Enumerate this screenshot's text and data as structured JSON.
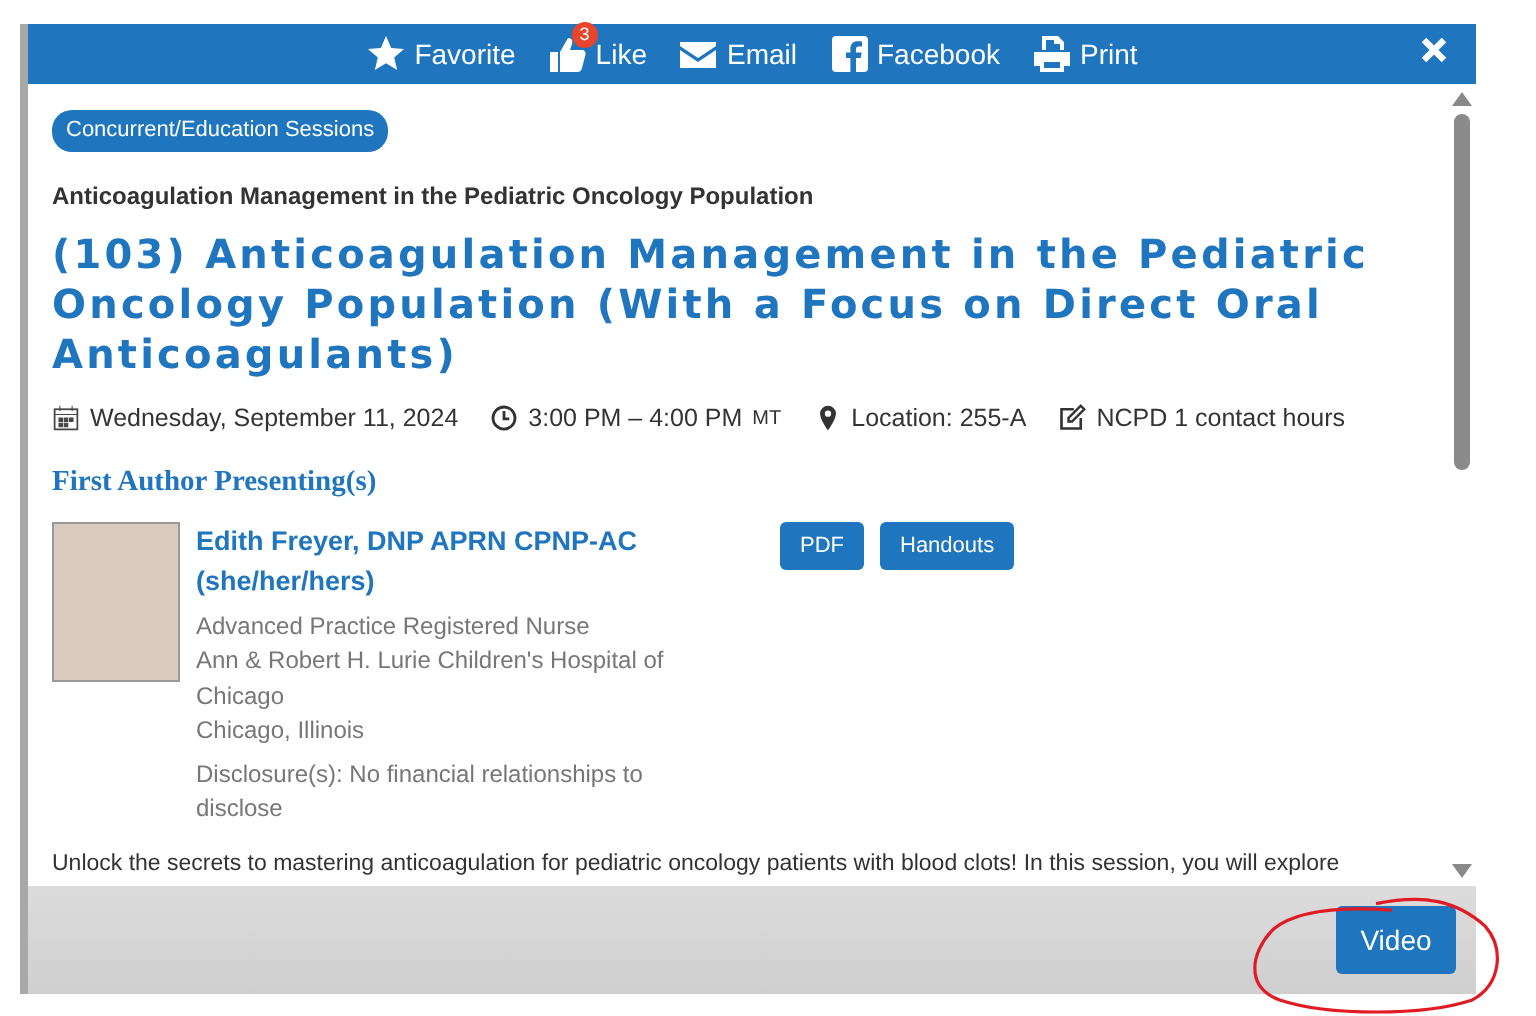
{
  "toolbar": {
    "items": [
      {
        "kind": "favorite",
        "label": "Favorite"
      },
      {
        "kind": "like",
        "label": "Like",
        "badge": "3"
      },
      {
        "kind": "email",
        "label": "Email"
      },
      {
        "kind": "facebook",
        "label": "Facebook"
      },
      {
        "kind": "print",
        "label": "Print"
      }
    ]
  },
  "session": {
    "category": "Concurrent/Education Sessions",
    "track": "Anticoagulation Management in the Pediatric Oncology Population",
    "title": "(103) Anticoagulation Management in the Pediatric Oncology Population (With a Focus on Direct Oral Anticoagulants)",
    "meta": [
      {
        "kind": "date",
        "text": "Wednesday, September 11, 2024"
      },
      {
        "kind": "time",
        "text": "3:00 PM – 4:00 PM",
        "suffix": "MT"
      },
      {
        "kind": "location",
        "text": "Location: 255-A"
      },
      {
        "kind": "credits",
        "text": "NCPD 1 contact hours"
      }
    ],
    "presenters_heading": "First Author Presenting(s)",
    "presenter": {
      "name": "Edith Freyer, DNP APRN CPNP-AC (she/her/hers)",
      "role": "Advanced Practice Registered Nurse",
      "organization": "Ann & Robert H. Lurie Children's Hospital of Chicago",
      "city": "Chicago, Illinois",
      "disclosure": "Disclosure(s): No financial relationships to disclose",
      "buttons": [
        "PDF",
        "Handouts"
      ]
    },
    "description": "Unlock the secrets to mastering anticoagulation for pediatric oncology patients with blood clots! In this session, you will explore"
  },
  "footer": {
    "buttons": [
      "Video"
    ]
  }
}
